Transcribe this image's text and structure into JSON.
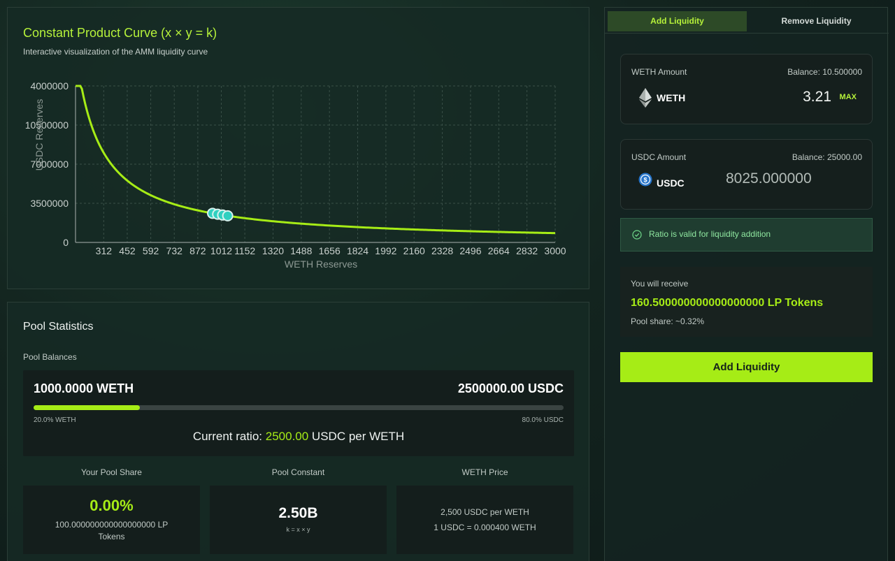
{
  "chart": {
    "title": "Constant Product Curve (x × y = k)",
    "subtitle": "Interactive visualization of the AMM liquidity curve"
  },
  "chart_data": {
    "type": "line",
    "title": "Constant Product Curve (x × y = k)",
    "xlabel": "WETH Reserves",
    "ylabel": "USDC Reserves",
    "k": 2500000000,
    "xlim": [
      144,
      3000
    ],
    "ylim": [
      0,
      14000000
    ],
    "x_ticks": [
      "312",
      "452",
      "592",
      "732",
      "872",
      "1012",
      "1152",
      "1320",
      "1488",
      "1656",
      "1824",
      "1992",
      "2160",
      "2328",
      "2496",
      "2664",
      "2832",
      "3000"
    ],
    "y_ticks": [
      "0",
      "3500000",
      "7000000",
      "10500000",
      "14000000"
    ],
    "y_tick_labels": [
      "0",
      "3500000",
      "7000000",
      "10500000",
      "4000000"
    ],
    "curve_color": "#a6ec16",
    "grid": true,
    "highlight_points": [
      {
        "x": 960,
        "y": 2604167
      },
      {
        "x": 990,
        "y": 2525253
      },
      {
        "x": 1020,
        "y": 2450980
      },
      {
        "x": 1050,
        "y": 2380952
      }
    ]
  },
  "stats": {
    "title": "Pool Statistics",
    "balances_label": "Pool Balances",
    "weth_balance": "1000.0000 WETH",
    "usdc_balance": "2500000.00 USDC",
    "weth_share_fraction": 0.2,
    "weth_pct": "20.0% WETH",
    "usdc_pct": "80.0% USDC",
    "ratio_prefix": "Current ratio: ",
    "ratio_value": "2500.00",
    "ratio_suffix": " USDC per WETH",
    "your_share_label": "Your Pool Share",
    "your_share_value": "0.00%",
    "your_share_tokens": "100.000000000000000000 LP Tokens",
    "constant_label": "Pool Constant",
    "constant_value": "2.50B",
    "constant_formula": "k = x × y",
    "price_label": "WETH Price",
    "price_line1": "2,500 USDC per WETH",
    "price_line2": "1 USDC = 0.000400 WETH"
  },
  "side": {
    "tab_add": "Add Liquidity",
    "tab_remove": "Remove Liquidity",
    "weth": {
      "label": "WETH Amount",
      "balance": "Balance: 10.500000",
      "symbol": "WETH",
      "amount": "3.21",
      "max": "MAX",
      "icon": "ethereum-icon"
    },
    "usdc": {
      "label": "USDC Amount",
      "balance": "Balance: 25000.00",
      "symbol": "USDC",
      "amount": "8025.000000",
      "icon": "usdc-icon"
    },
    "valid_text": "Ratio is valid for liquidity addition",
    "receive_label": "You will receive",
    "receive_amount": "160.500000000000000000 LP Tokens",
    "pool_share": "Pool share: ~0.32%",
    "add_button": "Add Liquidity"
  },
  "colors": {
    "accent": "#a6ec16",
    "success": "#8fe7a0",
    "card": "#141e1c"
  }
}
